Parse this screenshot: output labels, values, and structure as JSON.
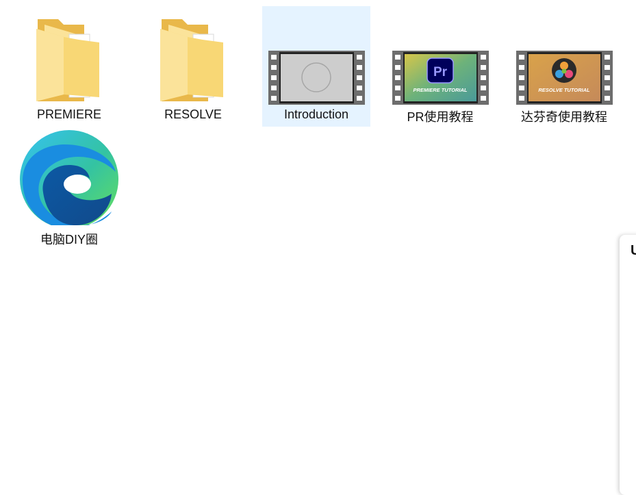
{
  "desktop": {
    "items": [
      {
        "label": "PREMIERE",
        "type": "folder"
      },
      {
        "label": "RESOLVE",
        "type": "folder"
      },
      {
        "label": "Introduction",
        "type": "video",
        "selected": true
      },
      {
        "label": "PR使用教程",
        "type": "video",
        "thumbnail_logo": "Pr",
        "thumbnail_caption": "PREMIERE TUTORIAL"
      },
      {
        "label": "达芬奇使用教程",
        "type": "video",
        "thumbnail_caption": "RESOLVE TUTORIAL"
      },
      {
        "label": "电脑DIY圈",
        "type": "shortcut",
        "icon": "edge-browser-icon"
      }
    ]
  },
  "side_panel": {
    "peek_text": "U"
  },
  "colors": {
    "selection": "#e5f3ff",
    "folder": "#f8d775",
    "premiere_purple": "#9999ff",
    "premiere_bg": "#00005b"
  }
}
